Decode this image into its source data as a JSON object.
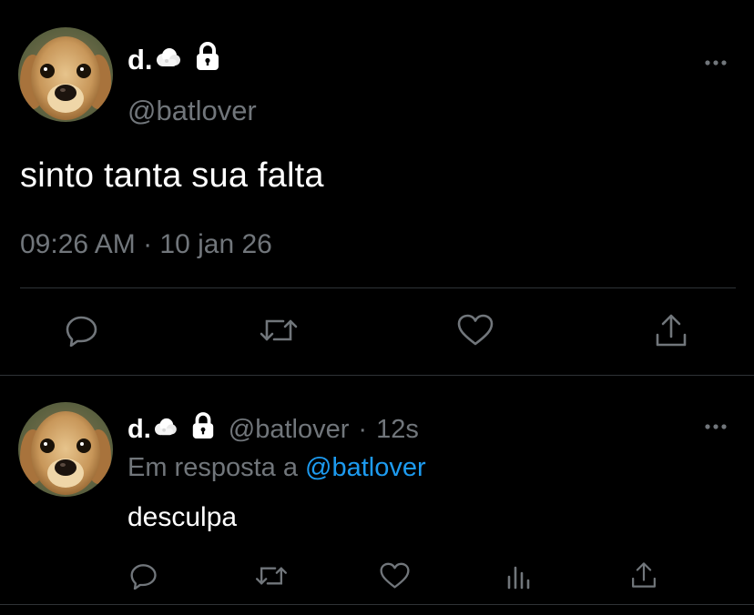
{
  "main_tweet": {
    "display_name": "d.",
    "name_emoji": "cloud-emoji",
    "protected_icon": "lock-icon",
    "handle": "@batlover",
    "text": "sinto tanta sua falta",
    "timestamp": "09:26 AM · 10 jan 26",
    "actions": [
      "reply-icon",
      "retweet-icon",
      "like-icon",
      "share-icon"
    ]
  },
  "reply_tweet": {
    "display_name": "d.",
    "name_emoji": "cloud-emoji",
    "protected_icon": "lock-icon",
    "handle": "@batlover",
    "separator": "·",
    "time": "12s",
    "replying_prefix": "Em resposta a",
    "replying_to": "@batlover",
    "text": "desculpa",
    "actions": [
      "reply-icon",
      "retweet-icon",
      "like-icon",
      "views-icon",
      "share-icon"
    ]
  },
  "colors": {
    "background": "#000000",
    "primary_text": "#ffffff",
    "secondary_text": "#71767b",
    "divider": "#2f3336",
    "link": "#1d9bf0"
  }
}
